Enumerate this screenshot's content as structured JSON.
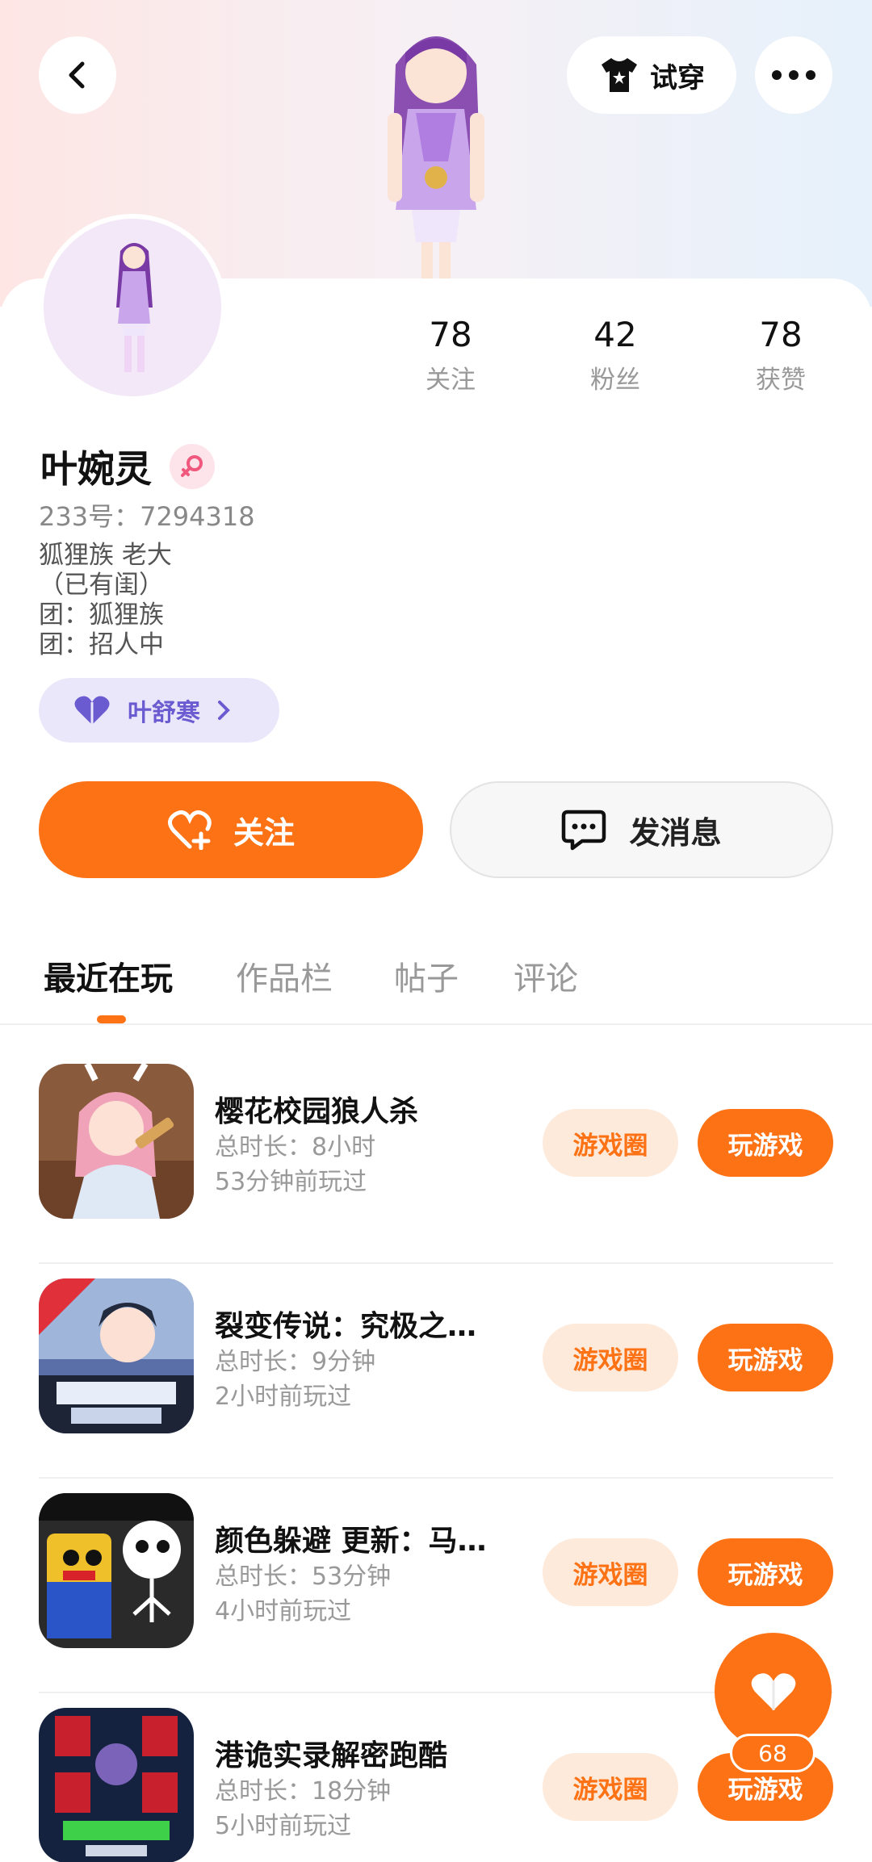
{
  "header": {
    "try_on_label": "试穿",
    "back_icon": "chevron-left-icon",
    "more_icon": "ellipsis-icon"
  },
  "profile": {
    "stats": [
      {
        "value": "78",
        "label": "关注"
      },
      {
        "value": "42",
        "label": "粉丝"
      },
      {
        "value": "78",
        "label": "获赞"
      }
    ],
    "nickname": "叶婉灵",
    "gender_icon": "female-icon",
    "uid": "233号：7294318",
    "bio": "狐狸族 老大\n（已有闺）\n团：狐狸族\n团：招人中",
    "cp_tag": "叶舒寒"
  },
  "actions": {
    "follow_label": "关注",
    "message_label": "发消息"
  },
  "tabs": [
    "最近在玩",
    "作品栏",
    "帖子",
    "评论"
  ],
  "games": [
    {
      "title": "樱花校园狼人杀",
      "duration": "总时长：8小时",
      "last_played": "53分钟前玩过"
    },
    {
      "title": "裂变传说：究极之…",
      "duration": "总时长：9分钟",
      "last_played": "2小时前玩过"
    },
    {
      "title": "颜色躲避 更新：马…",
      "duration": "总时长：53分钟",
      "last_played": "4小时前玩过"
    },
    {
      "title": "港诡实录解密跑酷",
      "duration": "总时长：18分钟",
      "last_played": "5小时前玩过"
    }
  ],
  "game_buttons": {
    "circle": "游戏圈",
    "play": "玩游戏"
  },
  "like": {
    "count": "68"
  },
  "colors": {
    "accent": "#fd7215",
    "accent_light": "#fdeadb",
    "cp_tag_bg": "#ebe7fb",
    "cp_tag_text": "#6b5bd1"
  }
}
